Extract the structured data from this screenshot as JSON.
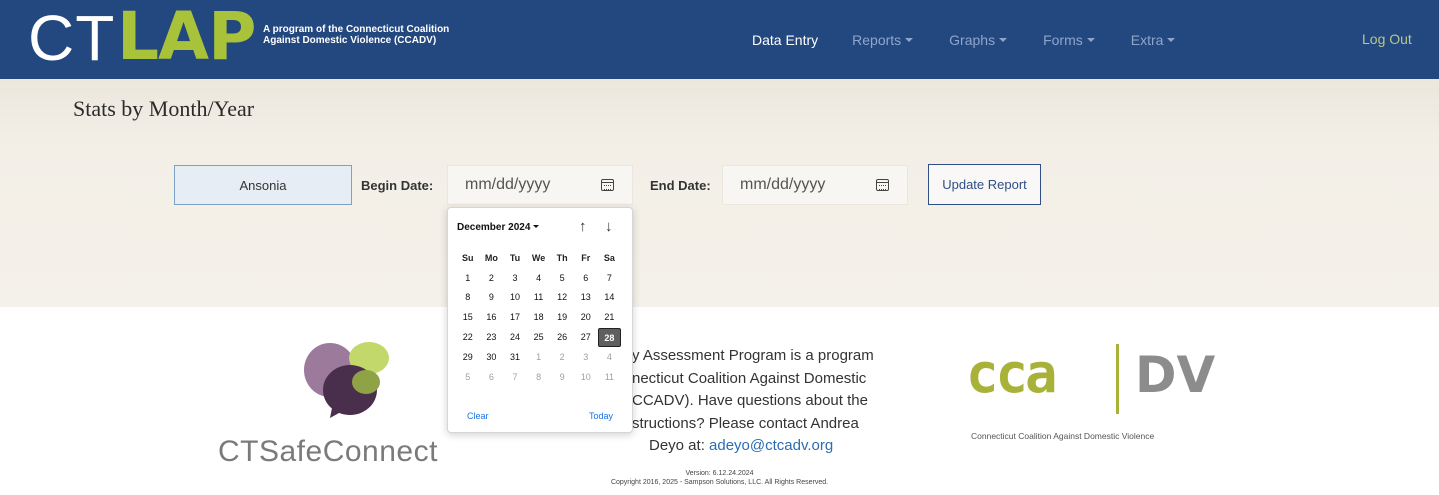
{
  "header": {
    "logo_ct": "CT",
    "logo_lap": "LAP",
    "tagline_line1": "A program of the Connecticut Coalition",
    "tagline_line2": "Against Domestic Violence (CCADV)",
    "nav": [
      {
        "label": "Data Entry",
        "active": true
      },
      {
        "label": "Reports",
        "dropdown": true
      },
      {
        "label": "Graphs",
        "dropdown": true
      },
      {
        "label": "Forms",
        "dropdown": true
      },
      {
        "label": "Extra",
        "dropdown": true
      }
    ],
    "logout": "Log Out"
  },
  "page": {
    "title": "Stats by Month/Year"
  },
  "filters": {
    "site": "Ansonia",
    "begin_label": "Begin Date:",
    "begin_placeholder": "mm/dd/yyyy",
    "end_label": "End Date:",
    "end_placeholder": "mm/dd/yyyy",
    "update_button": "Update Report"
  },
  "datepicker": {
    "month_label": "December 2024",
    "weekdays": [
      "Su",
      "Mo",
      "Tu",
      "We",
      "Th",
      "Fr",
      "Sa"
    ],
    "weeks": [
      [
        "1",
        "2",
        "3",
        "4",
        "5",
        "6",
        "7"
      ],
      [
        "8",
        "9",
        "10",
        "11",
        "12",
        "13",
        "14"
      ],
      [
        "15",
        "16",
        "17",
        "18",
        "19",
        "20",
        "21"
      ],
      [
        "22",
        "23",
        "24",
        "25",
        "26",
        "27",
        "28"
      ],
      [
        "29",
        "30",
        "31",
        "1",
        "2",
        "3",
        "4"
      ],
      [
        "5",
        "6",
        "7",
        "8",
        "9",
        "10",
        "11"
      ]
    ],
    "selected": "28",
    "clear": "Clear",
    "today": "Today",
    "up_arrow": "↑",
    "down_arrow": "↓"
  },
  "footer": {
    "text_part1": "y Assessment Program is a program",
    "text_part2": "necticut Coalition Against Domestic",
    "text_part3": "CCADV). Have questions about the",
    "text_part4": "structions? Please contact Andrea",
    "text_part5_prefix": "Deyo at: ",
    "email": "adeyo@ctcadv.org",
    "version": "Version: 6.12.24.2024",
    "copyright": "Copyright 2016, 2025 - Sampson Solutions, LLC. All Rights Reserved.",
    "ctsafe_label": "CTSafeConnect",
    "cca_logo_text": "cca",
    "dv_logo_text": "DV",
    "cca_subtitle": "Connecticut Coalition Against Domestic Violence"
  },
  "colors": {
    "navbar": "#23477f",
    "logo_green": "#a8c23a",
    "link_blue": "#2d6cb0",
    "selected_day": "#5f5f5f"
  }
}
